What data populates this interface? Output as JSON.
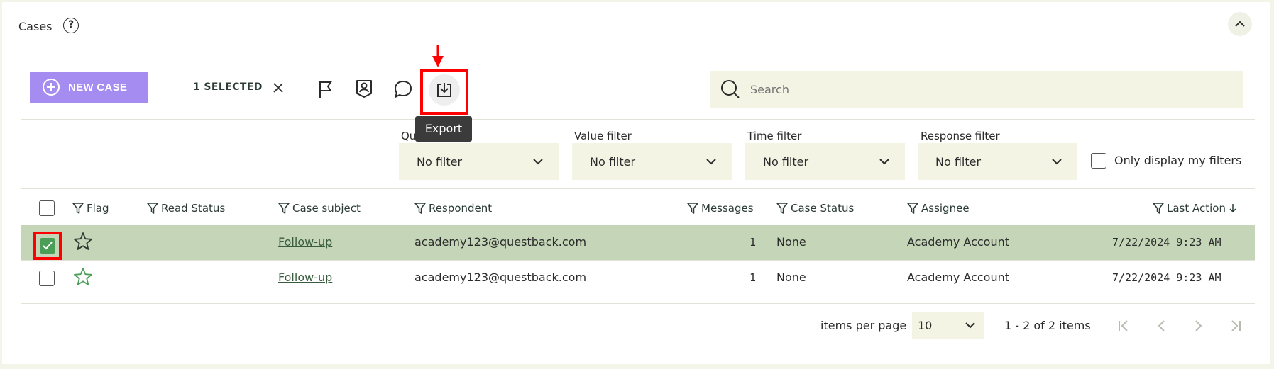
{
  "header": {
    "title": "Cases",
    "help_icon": "help-circle-icon"
  },
  "toolbar": {
    "new_case_label": "NEW CASE",
    "selected_label": "1 SELECTED",
    "tooltip": "Export",
    "search_placeholder": "Search"
  },
  "filters": {
    "quick": {
      "label": "Quick filter",
      "value": "No filter"
    },
    "value": {
      "label": "Value filter",
      "value": "No filter"
    },
    "time": {
      "label": "Time filter",
      "value": "No filter"
    },
    "response": {
      "label": "Response filter",
      "value": "No filter"
    },
    "only_mine_label": "Only display my filters"
  },
  "table": {
    "columns": [
      "Flag",
      "Read Status",
      "Case subject",
      "Respondent",
      "Messages",
      "Case Status",
      "Assignee",
      "Last Action"
    ],
    "rows": [
      {
        "subject": "Follow-up",
        "respondent": "academy123@questback.com",
        "messages": "1",
        "status": "None",
        "assignee": "Academy Account",
        "last_action": "7/22/2024 9:23 AM",
        "selected": true
      },
      {
        "subject": "Follow-up",
        "respondent": "academy123@questback.com",
        "messages": "1",
        "status": "None",
        "assignee": "Academy Account",
        "last_action": "7/22/2024 9:23 AM",
        "selected": false
      }
    ]
  },
  "pager": {
    "items_per_page_label": "items per page",
    "items_per_page": "10",
    "range": "1 - 2 of 2 items"
  },
  "colors": {
    "accent": "#a58cf0",
    "selected_row": "#c4d6b7",
    "field_bg": "#f3f4e3",
    "highlight": "#ff0000"
  }
}
